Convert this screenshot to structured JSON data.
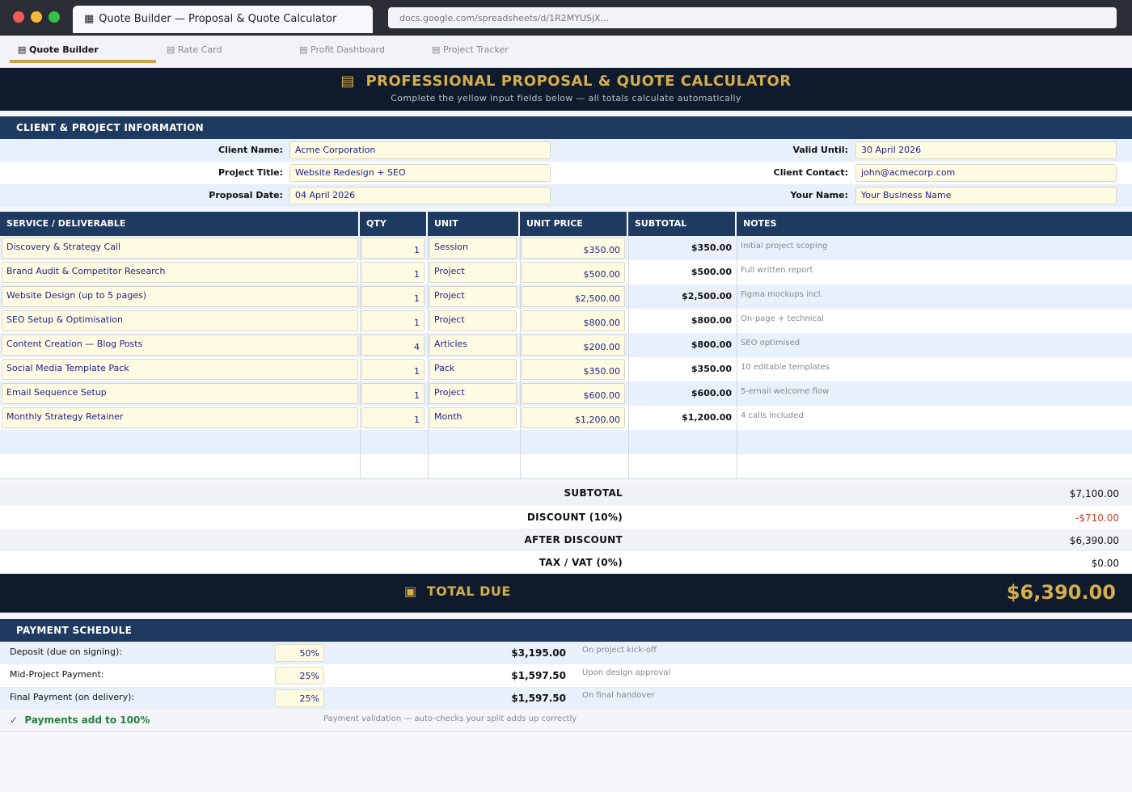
{
  "browser": {
    "tab_icon": "spreadsheet-icon",
    "tab_title": "Quote Builder — Proposal & Quote Calculator",
    "url": "docs.google.com/spreadsheets/d/1R2MYUSjX..."
  },
  "sheet_tabs": [
    {
      "label": "Quote Builder",
      "active": true
    },
    {
      "label": "Rate Card",
      "active": false
    },
    {
      "label": "Profit Dashboard",
      "active": false
    },
    {
      "label": "Project Tracker",
      "active": false
    }
  ],
  "header": {
    "title": "PROFESSIONAL PROPOSAL & QUOTE CALCULATOR",
    "subtitle": "Complete the yellow input fields below — all totals calculate automatically"
  },
  "client_section": {
    "heading": "CLIENT & PROJECT INFORMATION",
    "client_name_label": "Client Name:",
    "client_name": "Acme Corporation",
    "project_title_label": "Project Title:",
    "project_title": "Website Redesign + SEO",
    "proposal_date_label": "Proposal Date:",
    "proposal_date": "04 April 2026",
    "valid_until_label": "Valid Until:",
    "valid_until": "30 April 2026",
    "client_contact_label": "Client Contact:",
    "client_contact": "john@acmecorp.com",
    "your_name_label": "Your Name:",
    "your_name": "Your Business Name"
  },
  "table": {
    "headers": {
      "service": "SERVICE / DELIVERABLE",
      "qty": "QTY",
      "unit": "UNIT",
      "unit_price": "UNIT PRICE",
      "subtotal": "SUBTOTAL",
      "notes": "NOTES"
    },
    "rows": [
      {
        "service": "Discovery & Strategy Call",
        "qty": "1",
        "unit": "Session",
        "unit_price": "$350.00",
        "subtotal": "$350.00",
        "notes": "Initial project scoping"
      },
      {
        "service": "Brand Audit & Competitor Research",
        "qty": "1",
        "unit": "Project",
        "unit_price": "$500.00",
        "subtotal": "$500.00",
        "notes": "Full written report"
      },
      {
        "service": "Website Design (up to 5 pages)",
        "qty": "1",
        "unit": "Project",
        "unit_price": "$2,500.00",
        "subtotal": "$2,500.00",
        "notes": "Figma mockups incl."
      },
      {
        "service": "SEO Setup & Optimisation",
        "qty": "1",
        "unit": "Project",
        "unit_price": "$800.00",
        "subtotal": "$800.00",
        "notes": "On-page + technical"
      },
      {
        "service": "Content Creation — Blog Posts",
        "qty": "4",
        "unit": "Articles",
        "unit_price": "$200.00",
        "subtotal": "$800.00",
        "notes": "SEO optimised"
      },
      {
        "service": "Social Media Template Pack",
        "qty": "1",
        "unit": "Pack",
        "unit_price": "$350.00",
        "subtotal": "$350.00",
        "notes": "10 editable templates"
      },
      {
        "service": "Email Sequence Setup",
        "qty": "1",
        "unit": "Project",
        "unit_price": "$600.00",
        "subtotal": "$600.00",
        "notes": "5-email welcome flow"
      },
      {
        "service": "Monthly Strategy Retainer",
        "qty": "1",
        "unit": "Month",
        "unit_price": "$1,200.00",
        "subtotal": "$1,200.00",
        "notes": "4 calls included"
      }
    ]
  },
  "totals": {
    "subtotal_label": "SUBTOTAL",
    "subtotal": "$7,100.00",
    "discount_label": "DISCOUNT  (10%)",
    "discount": "-$710.00",
    "after_discount_label": "AFTER DISCOUNT",
    "after_discount": "$6,390.00",
    "tax_label": "TAX / VAT  (0%)",
    "tax": "$0.00",
    "total_due_label": "TOTAL DUE",
    "total_due": "$6,390.00"
  },
  "payment": {
    "heading": "PAYMENT SCHEDULE",
    "rows": [
      {
        "label": "Deposit (due on signing):",
        "pct": "50%",
        "amount": "$3,195.00",
        "note": "On project kick-off"
      },
      {
        "label": "Mid-Project Payment:",
        "pct": "25%",
        "amount": "$1,597.50",
        "note": "Upon design approval"
      },
      {
        "label": "Final Payment (on delivery):",
        "pct": "25%",
        "amount": "$1,597.50",
        "note": "On final handover"
      }
    ],
    "validation_ok": "Payments add to 100%",
    "validation_note": "Payment validation — auto-checks your split adds up correctly"
  },
  "colors": {
    "navy": "#0f1b2d",
    "section_blue": "#1f3a60",
    "gold": "#d4ae4c",
    "input_yellow": "#fffbe3",
    "input_text": "#1a1f8a",
    "negative": "#c0452e",
    "ok_green": "#2a8040"
  }
}
